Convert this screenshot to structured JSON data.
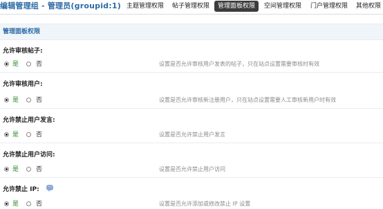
{
  "header": {
    "title": "编辑管理组 - 管理员(groupid:1)",
    "tabs": [
      {
        "label": "主题管理权限",
        "active": false
      },
      {
        "label": "帖子管理权限",
        "active": false
      },
      {
        "label": "管理面板权限",
        "active": true
      },
      {
        "label": "空间管理权限",
        "active": false
      },
      {
        "label": "门户管理权限",
        "active": false
      },
      {
        "label": "其他权限",
        "active": false
      }
    ]
  },
  "section": {
    "title": "管理面板权限"
  },
  "settings": [
    {
      "label": "允许审核帖子:",
      "yes": "是",
      "no": "否",
      "selected": "yes",
      "description": "设置是否允许审核用户发表的帖子，只在站点设置需要审核时有效"
    },
    {
      "label": "允许审核用户:",
      "yes": "是",
      "no": "否",
      "selected": "yes",
      "description": "设置是否允许审核新注册用户，只在站点设置需要人工审核新用户时有效"
    },
    {
      "label": "允许禁止用户发言:",
      "yes": "是",
      "no": "否",
      "selected": "yes",
      "description": "设置是否允许禁止用户发言"
    },
    {
      "label": "允许禁止用户访问:",
      "yes": "是",
      "no": "否",
      "selected": "yes",
      "description": "设置是否允许禁止用户访问"
    },
    {
      "label": "允许禁止 IP:",
      "yes": "是",
      "no": "否",
      "selected": "yes",
      "description": "设置是否允许添加或修改禁止 IP 设置"
    }
  ],
  "colors": {
    "accent": "#2b6aa6",
    "yes_text": "#2a8a2a",
    "active_tab_bg": "#3c3c3c"
  }
}
